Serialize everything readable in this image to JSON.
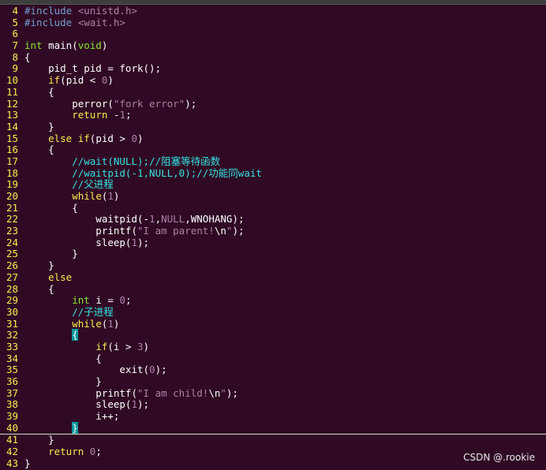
{
  "editor": {
    "lines": [
      {
        "n": "4",
        "tokens": [
          {
            "t": "#include ",
            "c": "pre"
          },
          {
            "t": "<unistd.h>",
            "c": "str"
          }
        ]
      },
      {
        "n": "5",
        "tokens": [
          {
            "t": "#include ",
            "c": "pre"
          },
          {
            "t": "<wait.h>",
            "c": "str"
          }
        ]
      },
      {
        "n": "6",
        "tokens": []
      },
      {
        "n": "7",
        "tokens": [
          {
            "t": "int",
            "c": "type"
          },
          {
            "t": " main(",
            "c": "plain"
          },
          {
            "t": "void",
            "c": "type"
          },
          {
            "t": ")",
            "c": "plain"
          }
        ]
      },
      {
        "n": "8",
        "tokens": [
          {
            "t": "{",
            "c": "plain"
          }
        ]
      },
      {
        "n": "9",
        "tokens": [
          {
            "t": "    pid_t pid = fork();",
            "c": "plain"
          }
        ]
      },
      {
        "n": "10",
        "tokens": [
          {
            "t": "    ",
            "c": "plain"
          },
          {
            "t": "if",
            "c": "kw"
          },
          {
            "t": "(pid < ",
            "c": "plain"
          },
          {
            "t": "0",
            "c": "num"
          },
          {
            "t": ")",
            "c": "plain"
          }
        ]
      },
      {
        "n": "11",
        "tokens": [
          {
            "t": "    {",
            "c": "plain"
          }
        ]
      },
      {
        "n": "12",
        "tokens": [
          {
            "t": "        perror(",
            "c": "plain"
          },
          {
            "t": "\"fork error\"",
            "c": "str"
          },
          {
            "t": ");",
            "c": "plain"
          }
        ]
      },
      {
        "n": "13",
        "tokens": [
          {
            "t": "        ",
            "c": "plain"
          },
          {
            "t": "return",
            "c": "kw"
          },
          {
            "t": " -",
            "c": "plain"
          },
          {
            "t": "1",
            "c": "num"
          },
          {
            "t": ";",
            "c": "plain"
          }
        ]
      },
      {
        "n": "14",
        "tokens": [
          {
            "t": "    }",
            "c": "plain"
          }
        ]
      },
      {
        "n": "15",
        "tokens": [
          {
            "t": "    ",
            "c": "plain"
          },
          {
            "t": "else if",
            "c": "kw"
          },
          {
            "t": "(pid > ",
            "c": "plain"
          },
          {
            "t": "0",
            "c": "num"
          },
          {
            "t": ")",
            "c": "plain"
          }
        ]
      },
      {
        "n": "16",
        "tokens": [
          {
            "t": "    {",
            "c": "plain"
          }
        ]
      },
      {
        "n": "17",
        "tokens": [
          {
            "t": "        //wait(NULL);//阻塞等待函数",
            "c": "cmt"
          }
        ]
      },
      {
        "n": "18",
        "tokens": [
          {
            "t": "        //waitpid(-1,NULL,0);//功能同wait",
            "c": "cmt"
          }
        ]
      },
      {
        "n": "19",
        "tokens": [
          {
            "t": "        //父进程",
            "c": "cmt"
          }
        ]
      },
      {
        "n": "20",
        "tokens": [
          {
            "t": "        ",
            "c": "plain"
          },
          {
            "t": "while",
            "c": "kw"
          },
          {
            "t": "(",
            "c": "plain"
          },
          {
            "t": "1",
            "c": "num"
          },
          {
            "t": ")",
            "c": "plain"
          }
        ]
      },
      {
        "n": "21",
        "tokens": [
          {
            "t": "        {",
            "c": "plain"
          }
        ]
      },
      {
        "n": "22",
        "tokens": [
          {
            "t": "            waitpid(-",
            "c": "plain"
          },
          {
            "t": "1",
            "c": "num"
          },
          {
            "t": ",",
            "c": "plain"
          },
          {
            "t": "NULL",
            "c": "num"
          },
          {
            "t": ",WNOHANG);",
            "c": "plain"
          }
        ]
      },
      {
        "n": "23",
        "tokens": [
          {
            "t": "            printf(",
            "c": "plain"
          },
          {
            "t": "\"I am parent!",
            "c": "str"
          },
          {
            "t": "\\n",
            "c": "plain"
          },
          {
            "t": "\"",
            "c": "str"
          },
          {
            "t": ");",
            "c": "plain"
          }
        ]
      },
      {
        "n": "24",
        "tokens": [
          {
            "t": "            sleep(",
            "c": "plain"
          },
          {
            "t": "1",
            "c": "num"
          },
          {
            "t": ");",
            "c": "plain"
          }
        ]
      },
      {
        "n": "25",
        "tokens": [
          {
            "t": "        }",
            "c": "plain"
          }
        ]
      },
      {
        "n": "26",
        "tokens": [
          {
            "t": "    }",
            "c": "plain"
          }
        ]
      },
      {
        "n": "27",
        "tokens": [
          {
            "t": "    ",
            "c": "plain"
          },
          {
            "t": "else",
            "c": "kw"
          }
        ]
      },
      {
        "n": "28",
        "tokens": [
          {
            "t": "    {",
            "c": "plain"
          }
        ]
      },
      {
        "n": "29",
        "tokens": [
          {
            "t": "        ",
            "c": "plain"
          },
          {
            "t": "int",
            "c": "type"
          },
          {
            "t": " i = ",
            "c": "plain"
          },
          {
            "t": "0",
            "c": "num"
          },
          {
            "t": ";",
            "c": "plain"
          }
        ]
      },
      {
        "n": "30",
        "tokens": [
          {
            "t": "        //子进程",
            "c": "cmt"
          }
        ]
      },
      {
        "n": "31",
        "tokens": [
          {
            "t": "        ",
            "c": "plain"
          },
          {
            "t": "while",
            "c": "kw"
          },
          {
            "t": "(",
            "c": "plain"
          },
          {
            "t": "1",
            "c": "num"
          },
          {
            "t": ")",
            "c": "plain"
          }
        ]
      },
      {
        "n": "32",
        "tokens": [
          {
            "t": "        ",
            "c": "plain"
          },
          {
            "t": "{",
            "c": "match"
          }
        ]
      },
      {
        "n": "33",
        "tokens": [
          {
            "t": "            ",
            "c": "plain"
          },
          {
            "t": "if",
            "c": "kw"
          },
          {
            "t": "(i > ",
            "c": "plain"
          },
          {
            "t": "3",
            "c": "num"
          },
          {
            "t": ")",
            "c": "plain"
          }
        ]
      },
      {
        "n": "34",
        "tokens": [
          {
            "t": "            {",
            "c": "plain"
          }
        ]
      },
      {
        "n": "35",
        "tokens": [
          {
            "t": "                exit(",
            "c": "plain"
          },
          {
            "t": "0",
            "c": "num"
          },
          {
            "t": ");",
            "c": "plain"
          }
        ]
      },
      {
        "n": "36",
        "tokens": [
          {
            "t": "            }",
            "c": "plain"
          }
        ]
      },
      {
        "n": "37",
        "tokens": [
          {
            "t": "            printf(",
            "c": "plain"
          },
          {
            "t": "\"I am child!",
            "c": "str"
          },
          {
            "t": "\\n",
            "c": "plain"
          },
          {
            "t": "\"",
            "c": "str"
          },
          {
            "t": ");",
            "c": "plain"
          }
        ]
      },
      {
        "n": "38",
        "tokens": [
          {
            "t": "            sleep(",
            "c": "plain"
          },
          {
            "t": "1",
            "c": "num"
          },
          {
            "t": ");",
            "c": "plain"
          }
        ]
      },
      {
        "n": "39",
        "tokens": [
          {
            "t": "            i++;",
            "c": "plain"
          }
        ]
      },
      {
        "n": "40",
        "tokens": [
          {
            "t": "        ",
            "c": "plain"
          },
          {
            "t": "}",
            "c": "match"
          }
        ],
        "cursor": true
      },
      {
        "n": "41",
        "tokens": [
          {
            "t": "    }",
            "c": "plain"
          }
        ]
      },
      {
        "n": "42",
        "tokens": [
          {
            "t": "    ",
            "c": "plain"
          },
          {
            "t": "return",
            "c": "kw"
          },
          {
            "t": " ",
            "c": "plain"
          },
          {
            "t": "0",
            "c": "num"
          },
          {
            "t": ";",
            "c": "plain"
          }
        ]
      },
      {
        "n": "43",
        "tokens": [
          {
            "t": "}",
            "c": "plain"
          }
        ]
      }
    ]
  },
  "watermark": "CSDN @.rookie",
  "colors": {
    "background": "#300a24",
    "line_number": "#fce94f",
    "preprocessor": "#729fcf",
    "string": "#ad7fa8",
    "keyword": "#fce94f",
    "type": "#8ae234",
    "comment": "#34e2e2",
    "match_highlight": "#06989a"
  }
}
